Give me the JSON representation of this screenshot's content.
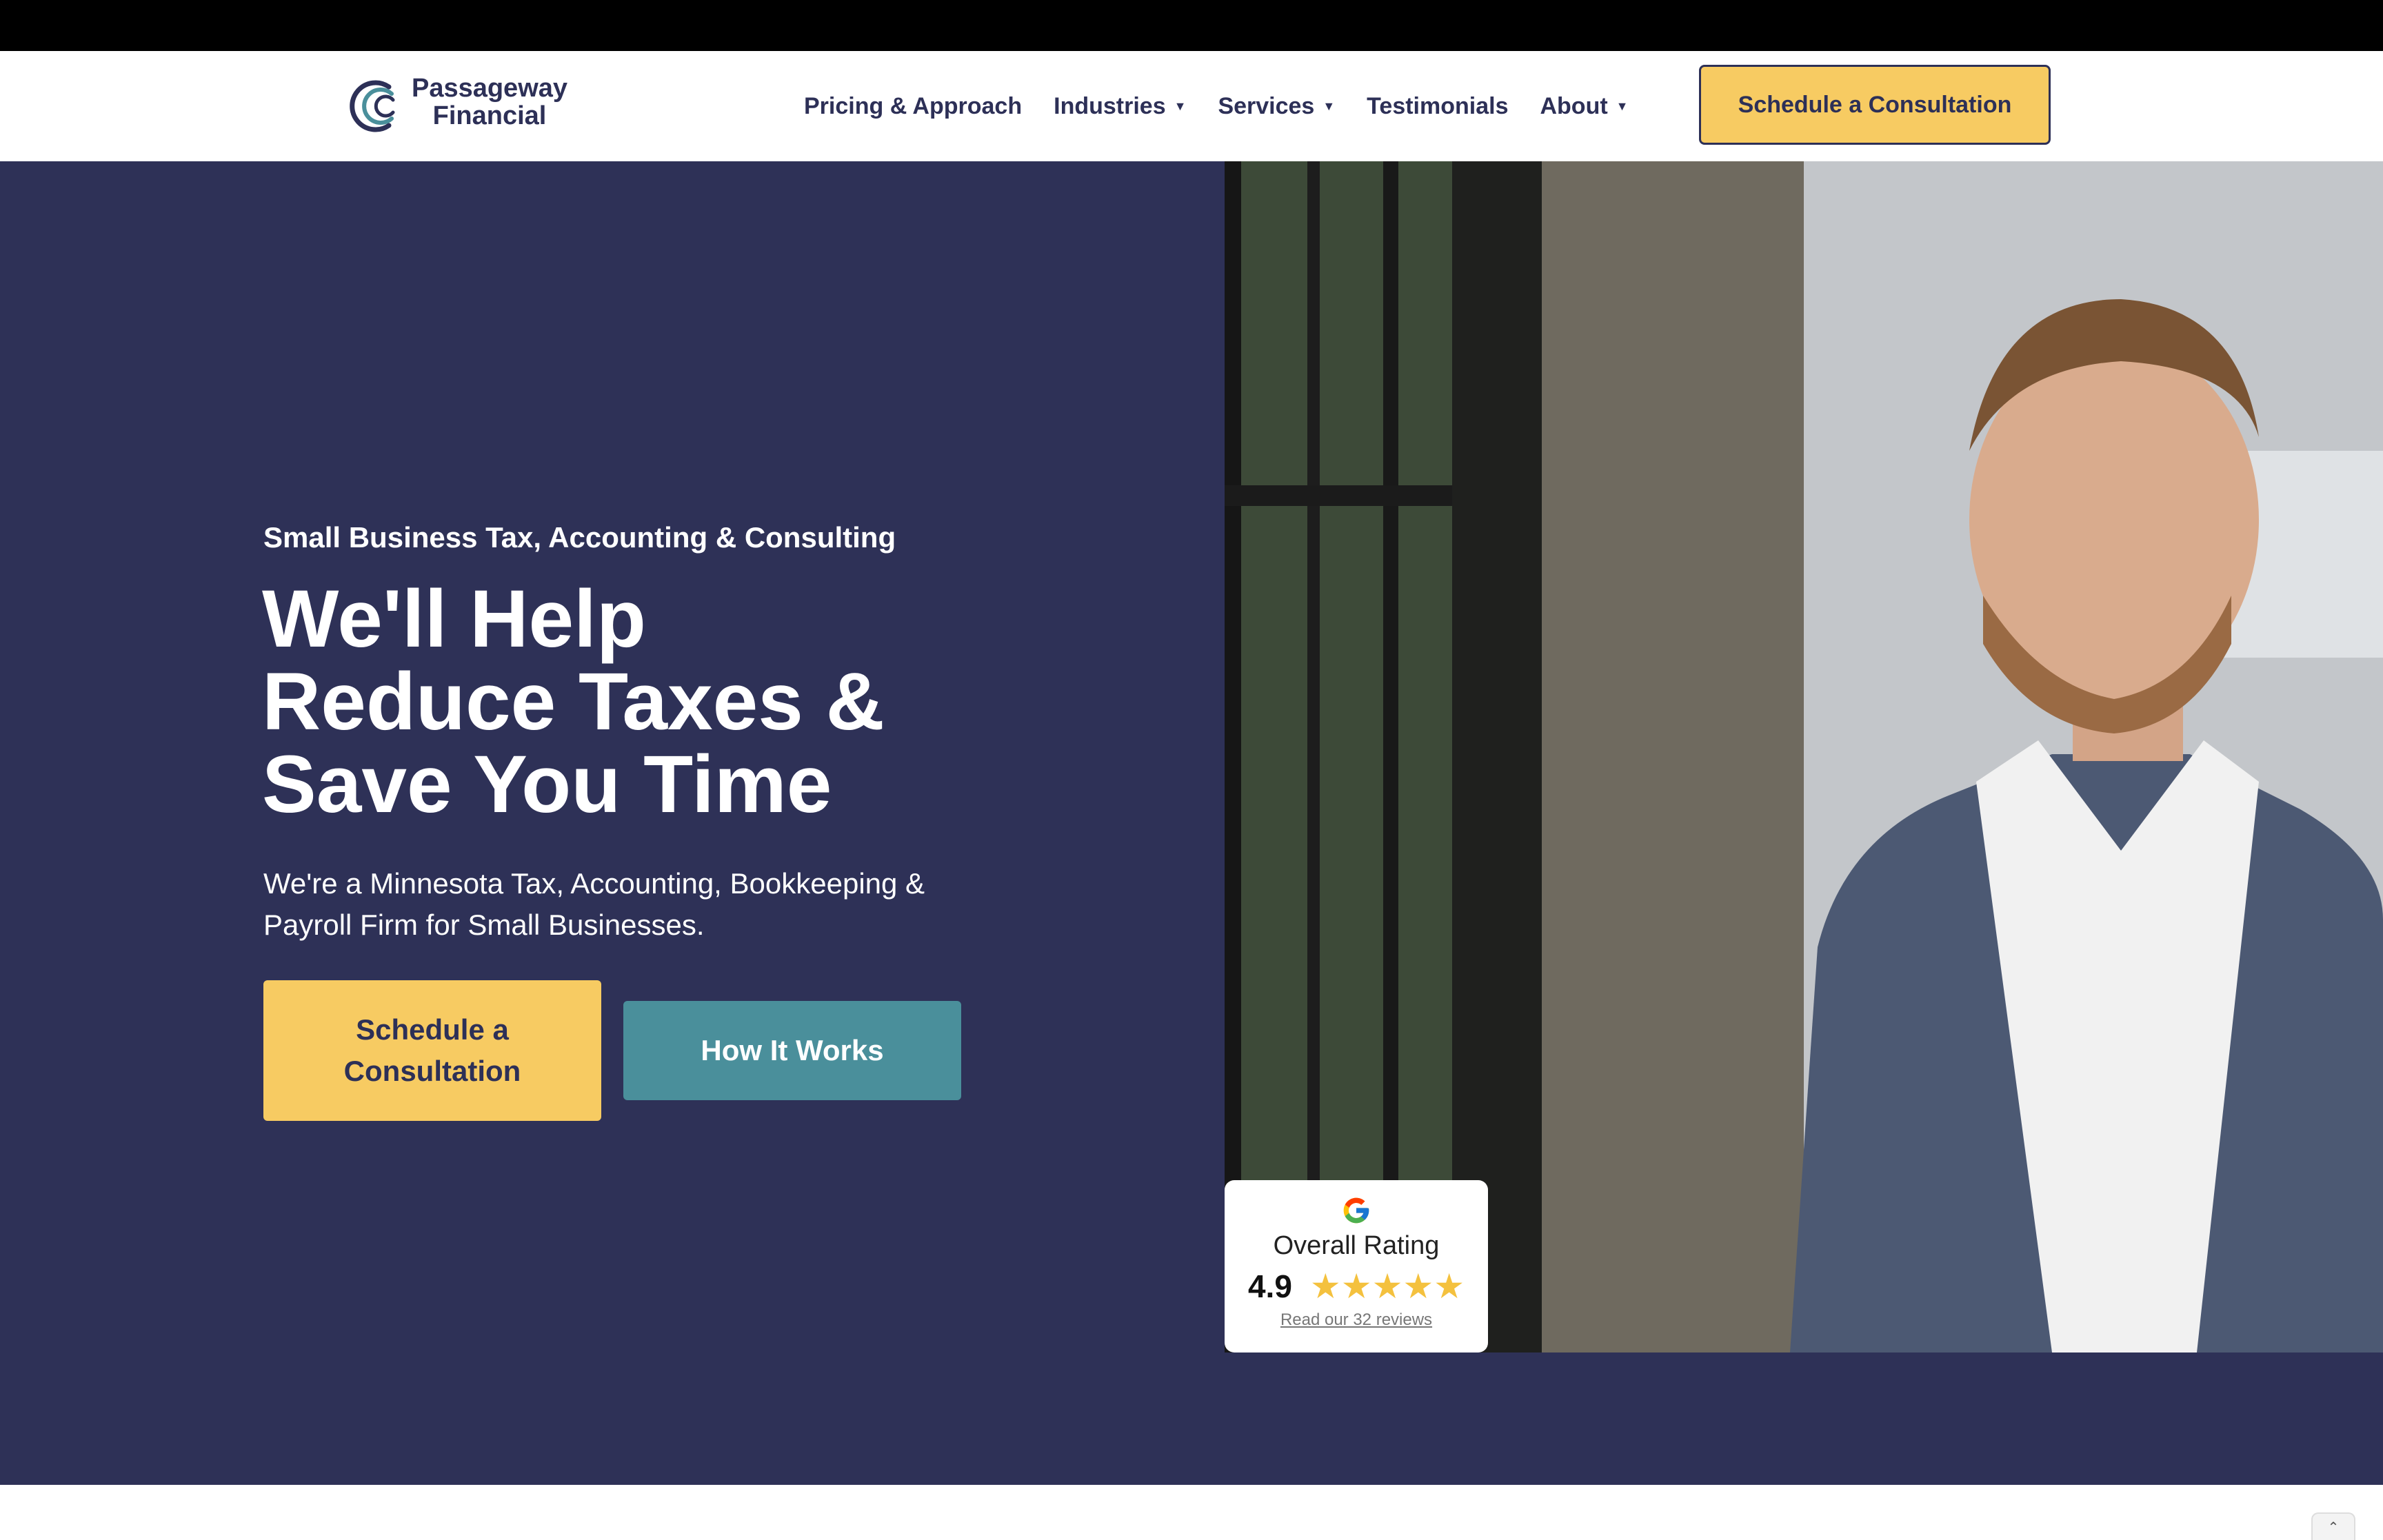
{
  "brand": {
    "line1": "Passageway",
    "line2": "Financial",
    "logo_icon": "swoosh-logo-icon",
    "colors": {
      "navy": "#2d3057",
      "teal": "#4a8f9b",
      "yellow": "#f7cb62"
    }
  },
  "nav": {
    "items": [
      {
        "label": "Pricing & Approach",
        "dropdown": false
      },
      {
        "label": "Industries",
        "dropdown": true
      },
      {
        "label": "Services",
        "dropdown": true
      },
      {
        "label": "Testimonials",
        "dropdown": false
      },
      {
        "label": "About",
        "dropdown": true
      }
    ],
    "cta": "Schedule a Consultation"
  },
  "hero": {
    "eyebrow": "Small Business Tax, Accounting & Consulting",
    "headline": "We'll Help Reduce Taxes & Save You Time",
    "subhead": "We're a Minnesota Tax, Accounting, Bookkeeping & Payroll Firm for Small Businesses.",
    "primary_button": "Schedule a Consultation",
    "secondary_button": "How It Works"
  },
  "rating": {
    "icon": "google-icon",
    "label": "Overall Rating",
    "score": "4.9",
    "stars": 5,
    "link": "Read our 32 reviews"
  },
  "scroll_top_icon": "chevron-up-icon"
}
